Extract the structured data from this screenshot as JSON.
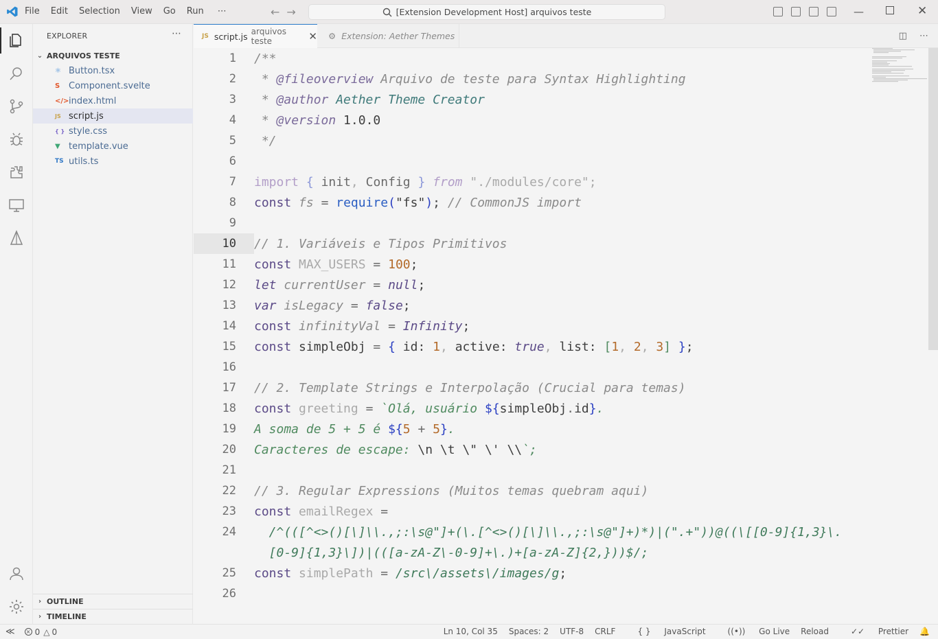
{
  "titlebar": {
    "menu": [
      "File",
      "Edit",
      "Selection",
      "View",
      "Go",
      "Run",
      "⋯"
    ],
    "search_text": "[Extension Development Host] arquivos teste"
  },
  "sidebar": {
    "title": "EXPLORER",
    "more": "⋯",
    "folder": "ARQUIVOS TESTE",
    "files": [
      {
        "name": "Button.tsx",
        "icon": "⚛",
        "icon_color": "#4a90d9"
      },
      {
        "name": "Component.svelte",
        "icon": "S",
        "icon_color": "#e2572b"
      },
      {
        "name": "index.html",
        "icon": "</>",
        "icon_color": "#e2572b"
      },
      {
        "name": "script.js",
        "icon": "JS",
        "icon_color": "#c8a24a"
      },
      {
        "name": "style.css",
        "icon": "{ }",
        "icon_color": "#7a66c9"
      },
      {
        "name": "template.vue",
        "icon": "▼",
        "icon_color": "#3fa776"
      },
      {
        "name": "utils.ts",
        "icon": "TS",
        "icon_color": "#3178c6"
      }
    ],
    "outline": "OUTLINE",
    "timeline": "TIMELINE"
  },
  "tabs": {
    "active": {
      "icon": "JS",
      "name": "script.js",
      "desc": "arquivos teste",
      "close": "✕"
    },
    "inactive": {
      "name": "Extension: Aether Themes"
    }
  },
  "code": {
    "line_numbers": [
      "1",
      "2",
      "3",
      "4",
      "5",
      "6",
      "7",
      "8",
      "9",
      "10",
      "11",
      "12",
      "13",
      "14",
      "15",
      "16",
      "17",
      "18",
      "19",
      "20",
      "21",
      "22",
      "23",
      "24",
      "",
      "25",
      "26"
    ],
    "current_line": "10"
  },
  "status": {
    "errors": "0",
    "warnings": "0",
    "position": "Ln 10, Col 35",
    "spaces": "Spaces: 2",
    "encoding": "UTF-8",
    "eol": "CRLF",
    "language": "JavaScript",
    "golive": "Go Live",
    "reload": "Reload",
    "prettier": "Prettier"
  }
}
